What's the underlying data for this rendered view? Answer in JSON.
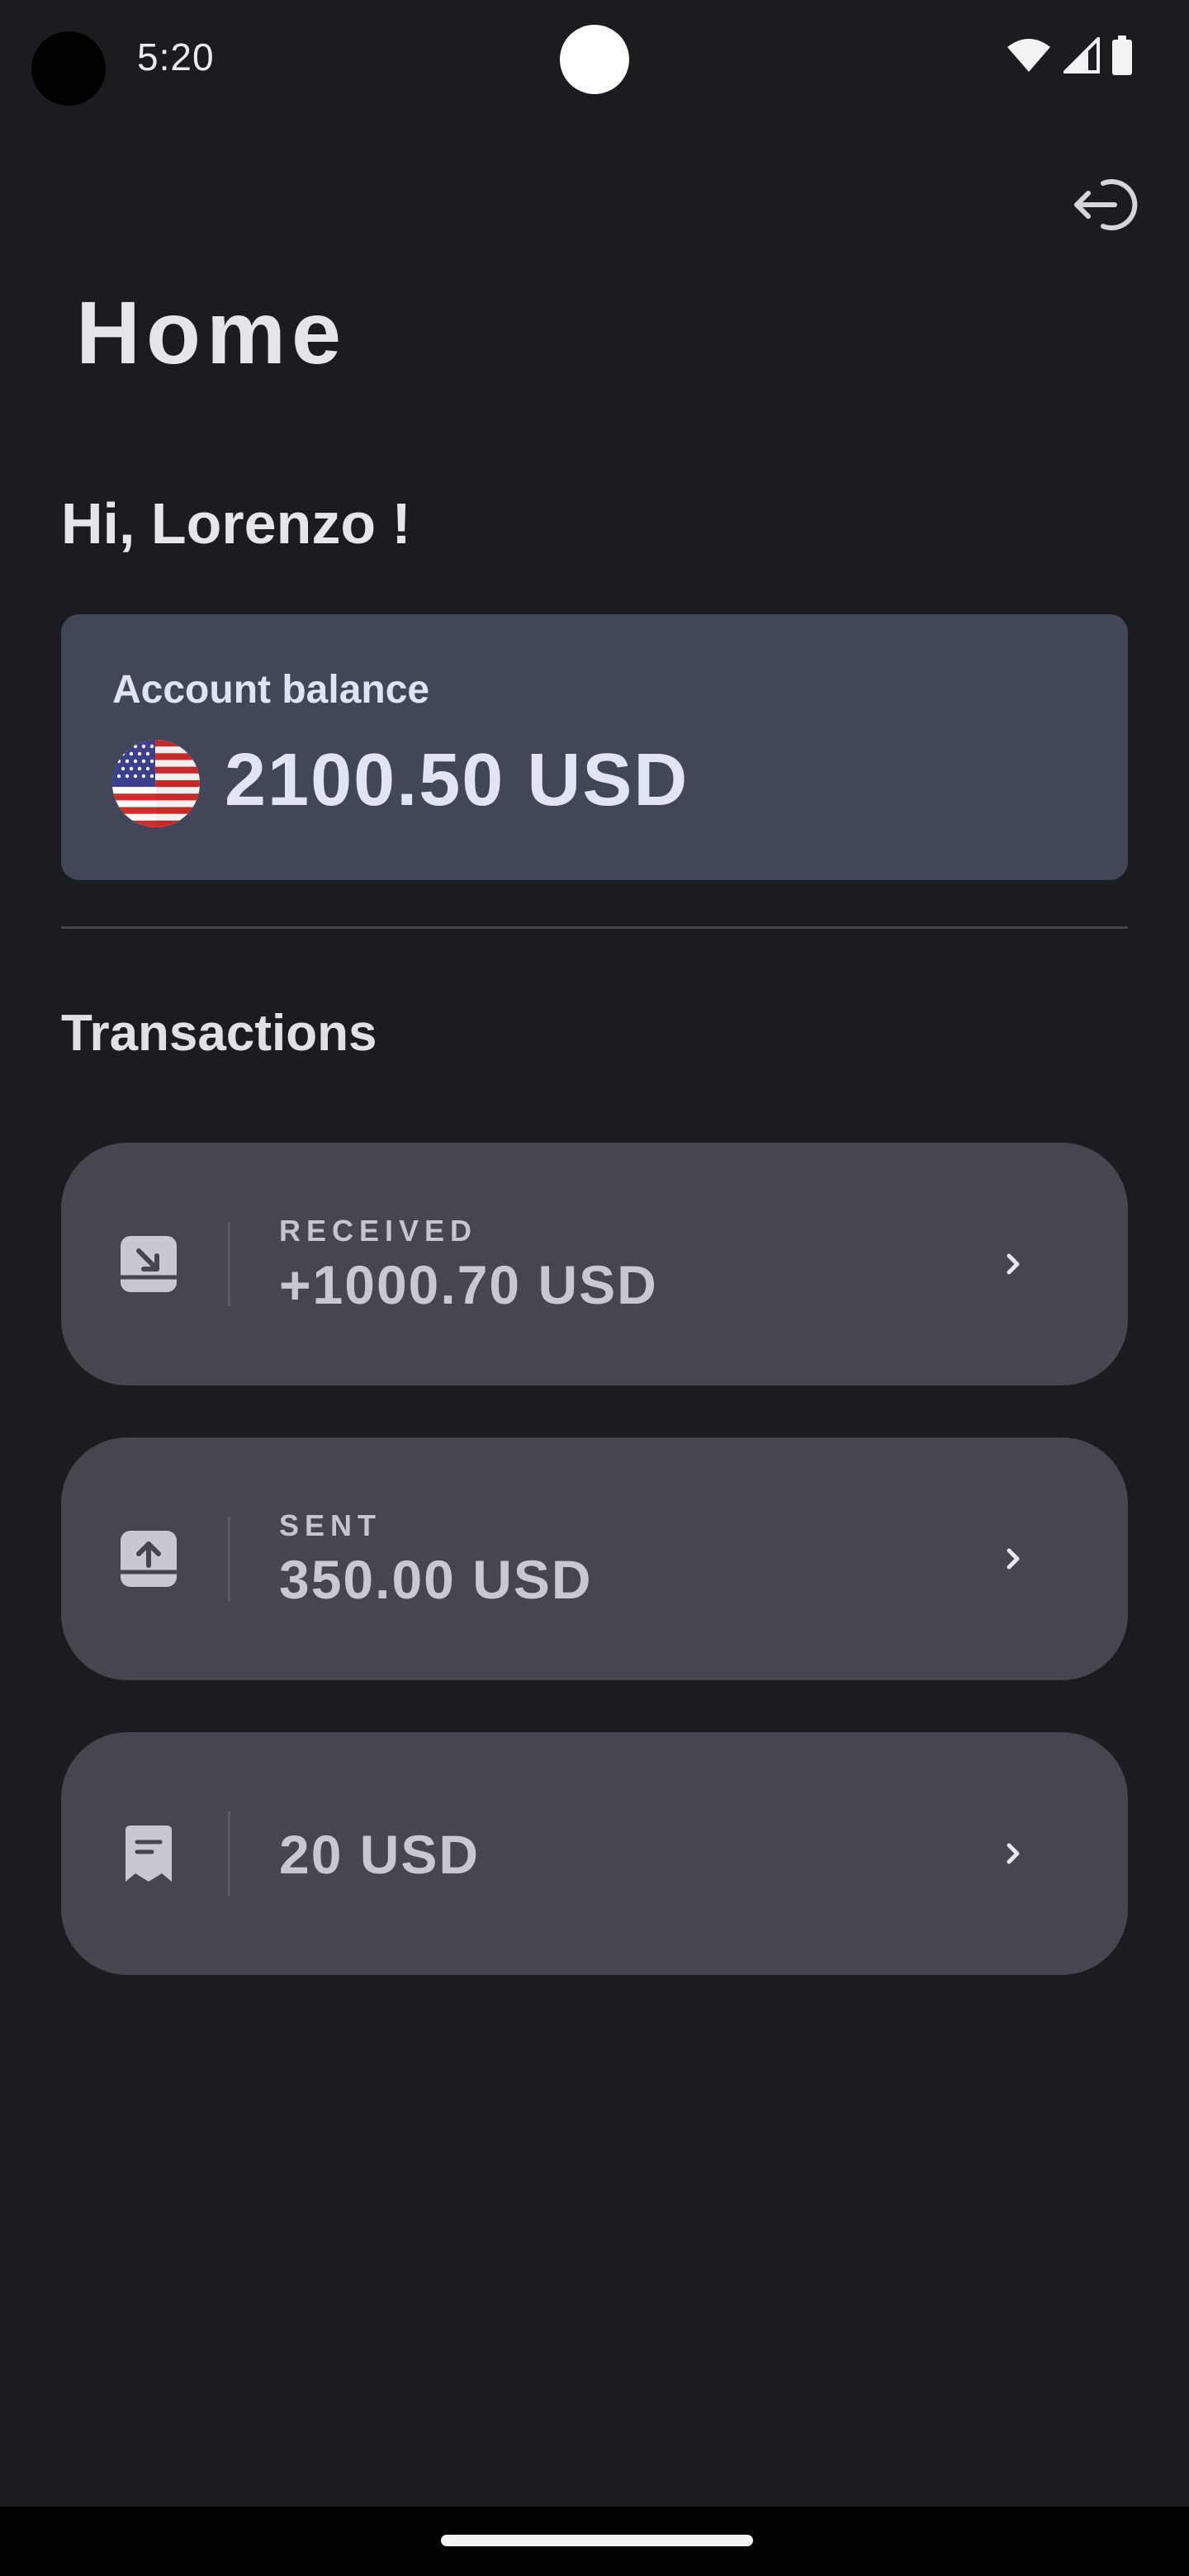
{
  "status_bar": {
    "time": "5:20",
    "icons": [
      "wifi-icon",
      "cell-signal-icon",
      "battery-icon"
    ]
  },
  "header": {
    "title": "Home",
    "logout_icon": "logout-icon"
  },
  "greeting": "Hi, Lorenzo !",
  "balance": {
    "label": "Account balance",
    "amount": "2100.50 USD",
    "flag_icon": "us-flag-icon"
  },
  "transactions": {
    "title": "Transactions",
    "items": [
      {
        "type": "RECEIVED",
        "amount": "+1000.70 USD",
        "icon": "download-tray-icon"
      },
      {
        "type": "SENT",
        "amount": "350.00 USD",
        "icon": "upload-tray-icon"
      },
      {
        "type": "",
        "amount": "20 USD",
        "icon": "receipt-icon"
      }
    ]
  },
  "colors": {
    "background": "#1b1c20",
    "balance_card": "#414759",
    "transaction_card": "#46464f",
    "text_primary": "#e4e4ea",
    "text_secondary": "#c6c5ce"
  }
}
